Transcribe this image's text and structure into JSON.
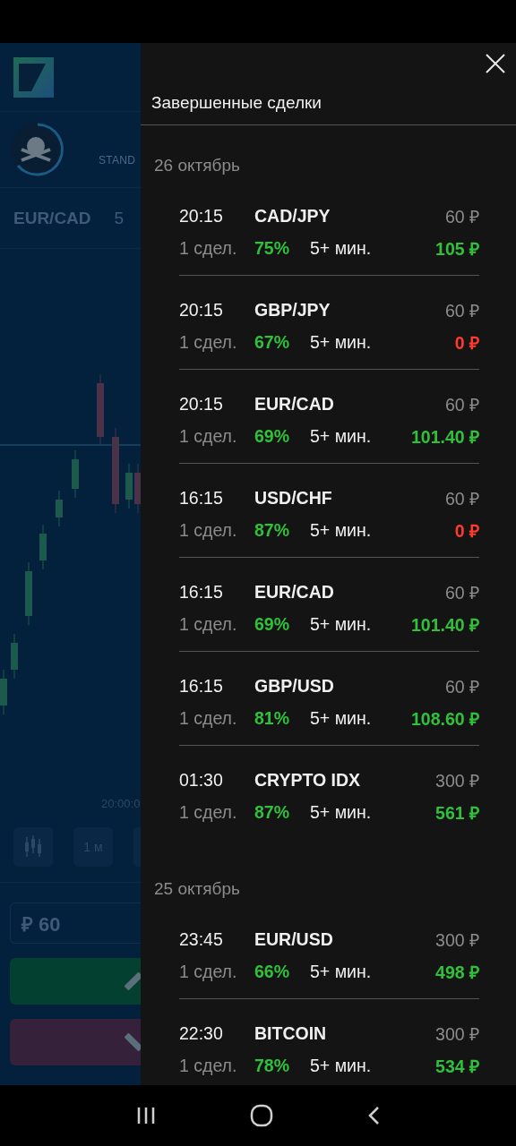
{
  "background": {
    "account_label": "STAND",
    "asset": "EUR/CAD",
    "asset_time": "5",
    "chart_time_label": "20:00:0",
    "timeframe": "1 м",
    "amount": "₽ 60"
  },
  "drawer": {
    "title": "Завершенные сделки",
    "groups": [
      {
        "date": "26 октябрь",
        "trades": [
          {
            "time": "20:15",
            "pair": "CAD/JPY",
            "stake": "60 ₽",
            "count": "1 сдел.",
            "percent": "75%",
            "duration": "5+ мин.",
            "payout": "105 ₽",
            "won": true
          },
          {
            "time": "20:15",
            "pair": "GBP/JPY",
            "stake": "60 ₽",
            "count": "1 сдел.",
            "percent": "67%",
            "duration": "5+ мин.",
            "payout": "0 ₽",
            "won": false
          },
          {
            "time": "20:15",
            "pair": "EUR/CAD",
            "stake": "60 ₽",
            "count": "1 сдел.",
            "percent": "69%",
            "duration": "5+ мин.",
            "payout": "101.40 ₽",
            "won": true
          },
          {
            "time": "16:15",
            "pair": "USD/CHF",
            "stake": "60 ₽",
            "count": "1 сдел.",
            "percent": "87%",
            "duration": "5+ мин.",
            "payout": "0 ₽",
            "won": false
          },
          {
            "time": "16:15",
            "pair": "EUR/CAD",
            "stake": "60 ₽",
            "count": "1 сдел.",
            "percent": "69%",
            "duration": "5+ мин.",
            "payout": "101.40 ₽",
            "won": true
          },
          {
            "time": "16:15",
            "pair": "GBP/USD",
            "stake": "60 ₽",
            "count": "1 сдел.",
            "percent": "81%",
            "duration": "5+ мин.",
            "payout": "108.60 ₽",
            "won": true
          },
          {
            "time": "01:30",
            "pair": "CRYPTO IDX",
            "stake": "300 ₽",
            "count": "1 сдел.",
            "percent": "87%",
            "duration": "5+ мин.",
            "payout": "561 ₽",
            "won": true
          }
        ]
      },
      {
        "date": "25 октябрь",
        "trades": [
          {
            "time": "23:45",
            "pair": "EUR/USD",
            "stake": "300 ₽",
            "count": "1 сдел.",
            "percent": "66%",
            "duration": "5+ мин.",
            "payout": "498 ₽",
            "won": true
          },
          {
            "time": "22:30",
            "pair": "BITCOIN",
            "stake": "300 ₽",
            "count": "1 сдел.",
            "percent": "78%",
            "duration": "5+ мин.",
            "payout": "534 ₽",
            "won": true
          }
        ]
      }
    ]
  }
}
